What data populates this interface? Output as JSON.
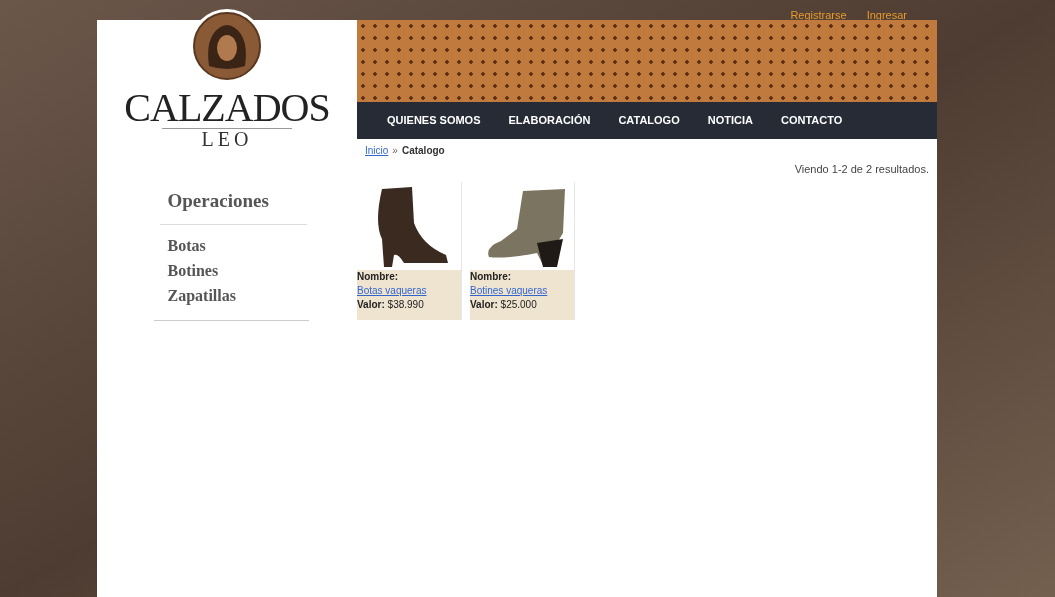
{
  "top_links": [
    "Registrarse",
    "Ingresar"
  ],
  "logo": {
    "title": "CALZADOS",
    "subtitle": "LEO"
  },
  "nav": [
    "QUIENES SOMOS",
    "ELABORACIÓN",
    "CATALOGO",
    "NOTICIA",
    "CONTACTO"
  ],
  "breadcrumb": {
    "link": "Inicio",
    "separator": "»",
    "current": "Catalogo"
  },
  "results": "Viendo 1-2 de 2 resultados.",
  "sidebar": {
    "title": "Operaciones",
    "items": [
      "Botas",
      "Botines",
      "Zapatillas"
    ]
  },
  "products": [
    {
      "kind": "boot",
      "name_label": "Nombre:",
      "name": "Botas vaqueras",
      "price_label": "Valor:",
      "price": "$38.990"
    },
    {
      "kind": "bootie",
      "name_label": "Nombre:",
      "name": "Botines vaqueras",
      "price_label": "Valor:",
      "price": "$25.000"
    }
  ]
}
